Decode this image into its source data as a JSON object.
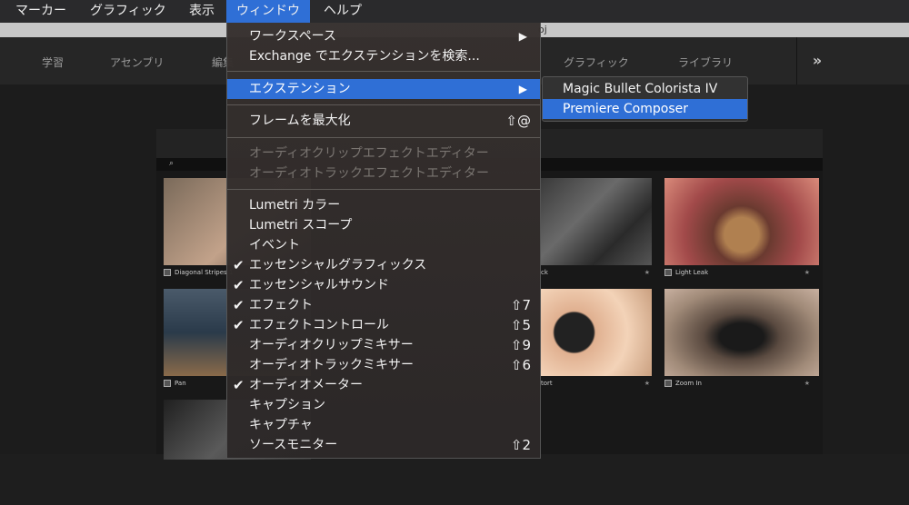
{
  "menubar": {
    "items": [
      {
        "label": "マーカー"
      },
      {
        "label": "グラフィック"
      },
      {
        "label": "表示"
      },
      {
        "label": "ウィンドウ"
      },
      {
        "label": "ヘルプ"
      }
    ]
  },
  "titlebar": {
    "fragment": "oj"
  },
  "workspaces": {
    "tabs": [
      "学習",
      "アセンブリ",
      "編集",
      "グラフィック",
      "ライブラリ"
    ],
    "more": "»"
  },
  "window_menu": {
    "items": [
      {
        "label": "ワークスペース",
        "submenu": "▶"
      },
      {
        "label": "Exchange でエクステンションを検索..."
      },
      {
        "label": "エクステンション",
        "submenu": "▶"
      },
      {
        "label": "フレームを最大化",
        "shortcut": "⇧@"
      },
      {
        "label": "オーディオクリップエフェクトエディター"
      },
      {
        "label": "オーディオトラックエフェクトエディター"
      },
      {
        "label": "Lumetri カラー"
      },
      {
        "label": "Lumetri スコープ"
      },
      {
        "label": "イベント"
      },
      {
        "label": "エッセンシャルグラフィックス",
        "check": "✔"
      },
      {
        "label": "エッセンシャルサウンド",
        "check": "✔"
      },
      {
        "label": "エフェクト",
        "check": "✔",
        "shortcut": "⇧7"
      },
      {
        "label": "エフェクトコントロール",
        "check": "✔",
        "shortcut": "⇧5"
      },
      {
        "label": "オーディオクリップミキサー",
        "shortcut": "⇧9"
      },
      {
        "label": "オーディオトラックミキサー",
        "shortcut": "⇧6"
      },
      {
        "label": "オーディオメーター",
        "check": "✔"
      },
      {
        "label": "キャプション"
      },
      {
        "label": "キャプチャ"
      },
      {
        "label": "ソースモニター",
        "shortcut": "⇧2"
      }
    ]
  },
  "extensions_submenu": {
    "items": [
      {
        "label": "Magic Bullet Colorista IV"
      },
      {
        "label": "Premiere Composer"
      }
    ]
  },
  "panel": {
    "search_icon": "magnifier-icon",
    "thumbnails": [
      {
        "label": "Diagonal Stripes 1"
      },
      {
        "label": "ck"
      },
      {
        "label": "Light Leak"
      },
      {
        "label": "Pan"
      },
      {
        "label": "tort"
      },
      {
        "label": "Zoom In"
      },
      {
        "label": ""
      }
    ]
  },
  "colors": {
    "accent": "#2f6fd6"
  }
}
